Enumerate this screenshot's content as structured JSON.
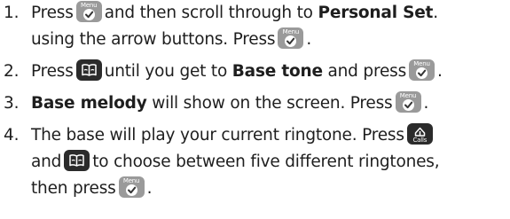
{
  "icons": {
    "menu_key": "menu-ok-key-icon",
    "book_key": "phonebook-key-icon",
    "calls_key": "calls-key-icon",
    "menu_label": "Menu",
    "calls_label": "Calls"
  },
  "colors": {
    "text": "#1e1e1e",
    "menu_key_bg": "#9a9a9a",
    "dark_key_bg": "#2b2b2b"
  },
  "steps": [
    {
      "number": "1.",
      "t1": "Press",
      "t2": "and then scroll through to",
      "b1": "Personal Set",
      "t3": ".",
      "t4": "using the arrow buttons. Press",
      "t5": "."
    },
    {
      "number": "2.",
      "t1": "Press",
      "t2": "until you get to",
      "b1": "Base tone",
      "t3": "and press",
      "t4": "."
    },
    {
      "number": "3.",
      "b1": "Base melody",
      "t1": "will show on the screen. Press",
      "t2": "."
    },
    {
      "number": "4.",
      "t1": "The base will play your current ringtone. Press",
      "t2": "and",
      "t3": "to choose between five different ringtones,",
      "t4": "then press",
      "t5": "."
    }
  ]
}
